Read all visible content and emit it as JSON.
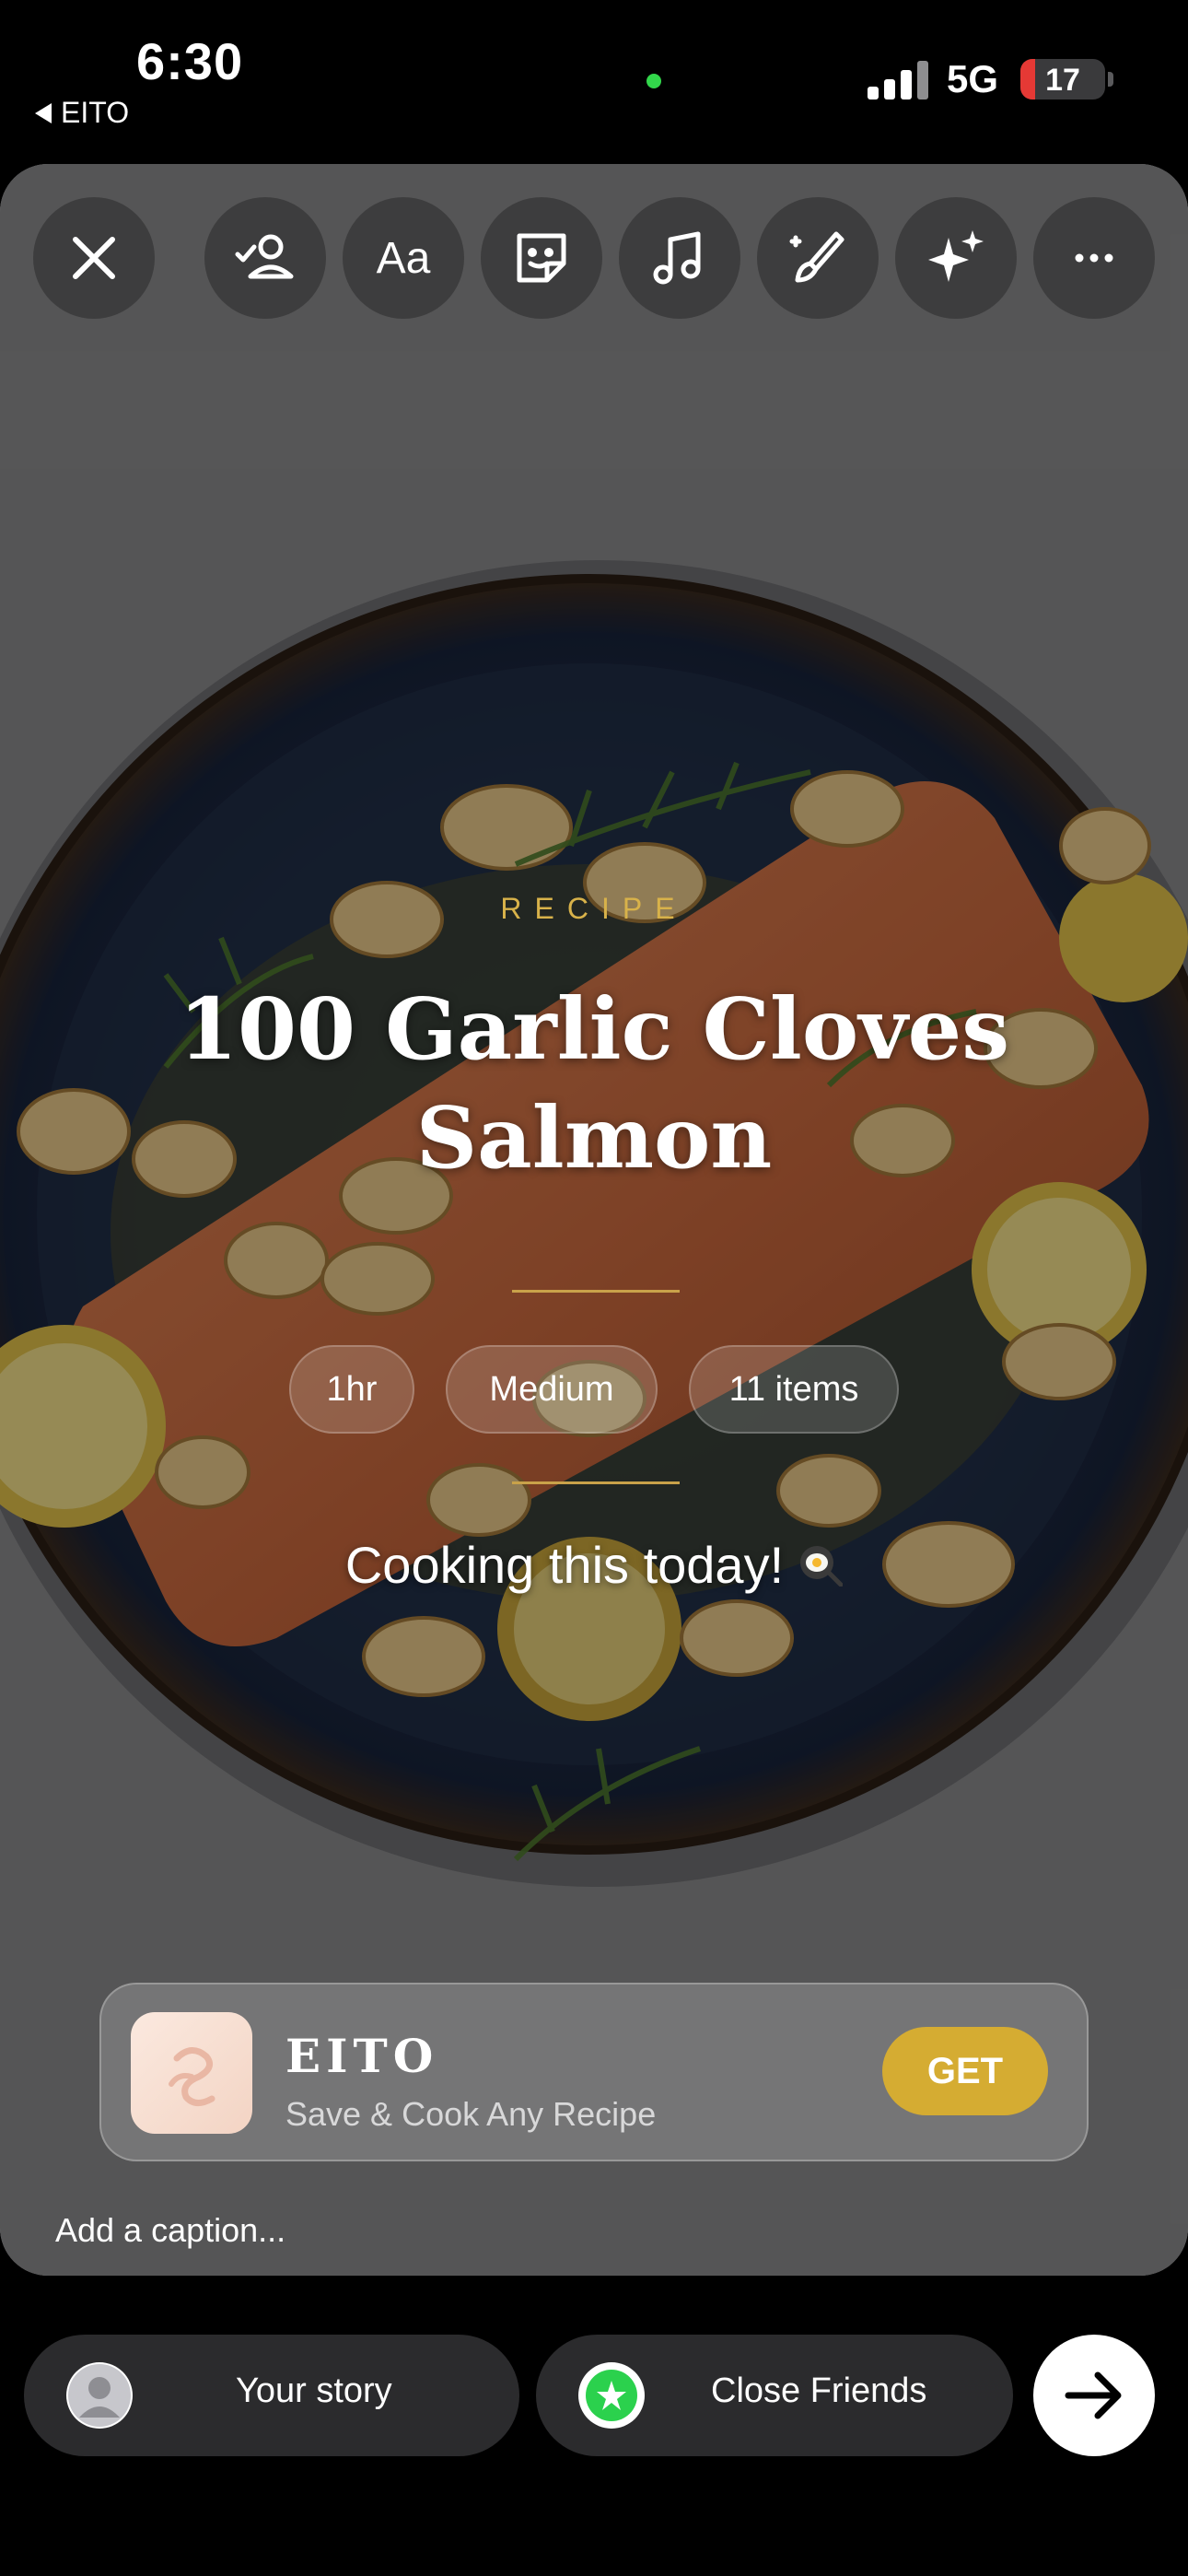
{
  "status_bar": {
    "time": "6:30",
    "back_app": "EITO",
    "network": "5G",
    "battery_level": "17",
    "battery_color": "#e53935",
    "camera_indicator_color": "#32d74b"
  },
  "toolbar": {
    "items": [
      {
        "name": "close",
        "icon": "close-icon"
      },
      {
        "name": "mention",
        "icon": "mention-person-icon"
      },
      {
        "name": "text",
        "icon": "text-aa-icon"
      },
      {
        "name": "sticker",
        "icon": "sticker-icon"
      },
      {
        "name": "music",
        "icon": "music-note-icon"
      },
      {
        "name": "draw",
        "icon": "draw-brush-icon"
      },
      {
        "name": "effects",
        "icon": "sparkles-icon"
      },
      {
        "name": "more",
        "icon": "more-icon"
      }
    ]
  },
  "recipe": {
    "kicker": "RECIPE",
    "title": "100 Garlic Cloves Salmon",
    "tags": [
      "1hr",
      "Medium",
      "11 items"
    ],
    "caption": "Cooking this today!",
    "caption_emoji": "fried-egg-pan-icon",
    "accent_color": "#d8b24a"
  },
  "app_card": {
    "name": "EITO",
    "subtitle": "Save & Cook Any Recipe",
    "cta": "GET",
    "cta_color": "#d5ac32"
  },
  "caption_input": {
    "placeholder": "Add a caption..."
  },
  "share_bar": {
    "your_story": "Your story",
    "close_friends": "Close Friends",
    "close_friends_color": "#2bd14d",
    "send_icon": "arrow-right-icon"
  }
}
